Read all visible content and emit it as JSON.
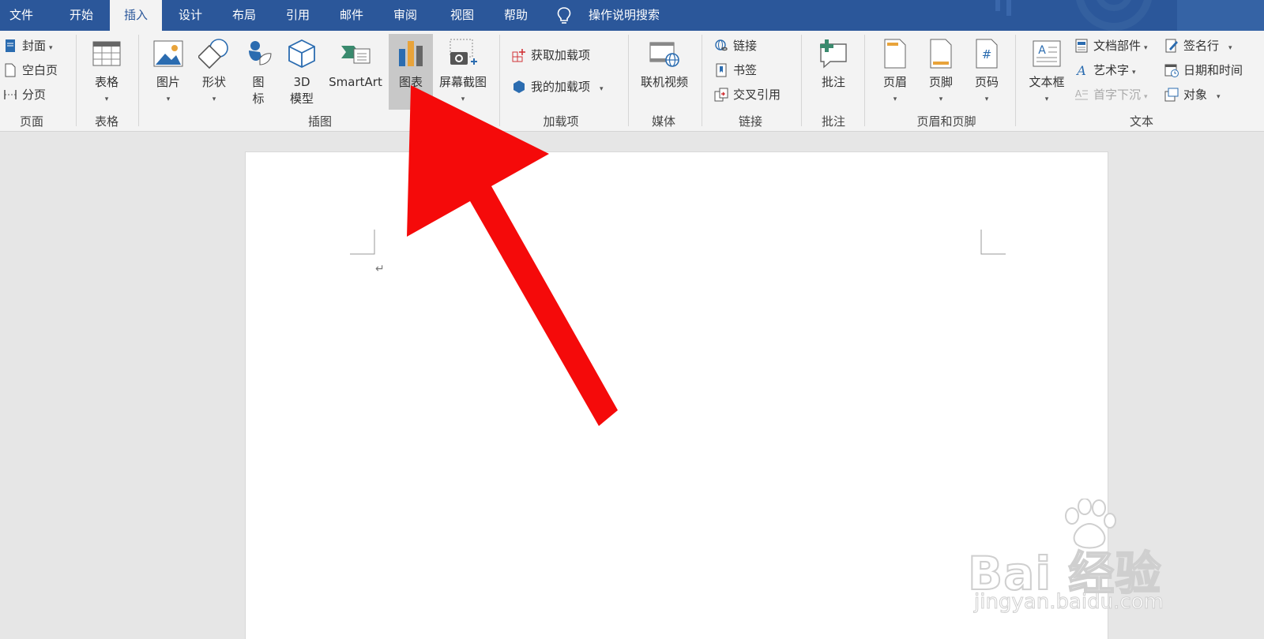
{
  "tabs": {
    "file": "文件",
    "home": "开始",
    "insert": "插入",
    "design": "设计",
    "layout": "布局",
    "references": "引用",
    "mailings": "邮件",
    "review": "审阅",
    "view": "视图",
    "help": "帮助",
    "tell_me": "操作说明搜索"
  },
  "groups": {
    "pages": {
      "label": "页面",
      "cover": "封面",
      "blank": "空白页",
      "break": "分页"
    },
    "tables": {
      "label": "表格",
      "table": "表格"
    },
    "illustrations": {
      "label": "插图",
      "pictures": "图片",
      "shapes": "形状",
      "icons_1": "图",
      "icons_2": "标",
      "model_1": "3D",
      "model_2": "模型",
      "smartart": "SmartArt",
      "chart": "图表",
      "screenshot": "屏幕截图"
    },
    "addins": {
      "label": "加载项",
      "get": "获取加载项",
      "mine": "我的加载项"
    },
    "media": {
      "label": "媒体",
      "online_video": "联机视频"
    },
    "links": {
      "label": "链接",
      "link": "链接",
      "bookmark": "书签",
      "cross_ref": "交叉引用"
    },
    "comments": {
      "label": "批注",
      "comment": "批注"
    },
    "header_footer": {
      "label": "页眉和页脚",
      "header": "页眉",
      "footer": "页脚",
      "page_number": "页码"
    },
    "text": {
      "label": "文本",
      "textbox": "文本框",
      "quick_parts": "文档部件",
      "wordart": "艺术字",
      "drop_cap": "首字下沉",
      "signature": "签名行",
      "date_time": "日期和时间",
      "object": "对象"
    }
  },
  "document": {
    "paragraph_mark": "↵"
  },
  "watermark": {
    "brand": "Bai  经验",
    "url": "jingyan.baidu.com"
  },
  "colors": {
    "tab_bar": "#2b579a",
    "ribbon": "#f3f3f3",
    "highlight": "#c8c8c8",
    "arrow": "#f50a0a"
  }
}
